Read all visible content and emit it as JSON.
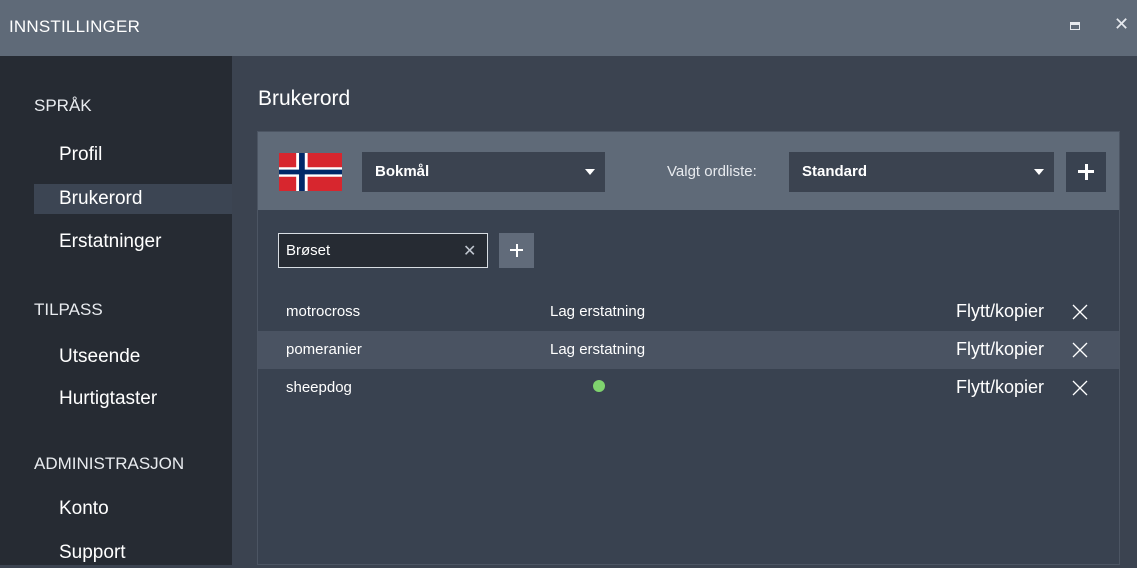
{
  "window": {
    "title": "INNSTILLINGER",
    "maximize_icon": "maximize-icon",
    "close_icon": "close-icon"
  },
  "sidebar": {
    "sections": [
      {
        "heading": "SPRÅK",
        "items": [
          "Profil",
          "Brukerord",
          "Erstatninger"
        ]
      },
      {
        "heading": "TILPASS",
        "items": [
          "Utseende",
          "Hurtigtaster"
        ]
      },
      {
        "heading": "ADMINISTRASJON",
        "items": [
          "Konto",
          "Support"
        ]
      }
    ],
    "active_item": "Brukerord"
  },
  "main": {
    "title": "Brukerord",
    "language": {
      "flag_icon": "norway-flag-icon",
      "selected": "Bokmål",
      "list_label": "Valgt ordliste:",
      "list_selected": "Standard",
      "add_list_icon": "plus-icon"
    },
    "search": {
      "value": "Brøset",
      "clear_icon": "clear-icon",
      "add_icon": "plus-icon"
    },
    "words": [
      {
        "word": "motrocross",
        "replacement": "Lag erstatning",
        "move": "Flytt/kopier"
      },
      {
        "word": "pomeranier",
        "replacement": "Lag erstatning",
        "move": "Flytt/kopier"
      },
      {
        "word": "sheepdog",
        "replacement": "",
        "status_dot": "green-dot",
        "move": "Flytt/kopier"
      }
    ],
    "colors": {
      "titlebar": "#5f6a78",
      "sidebar": "#262b33",
      "content": "#3b4350",
      "status_dot": "#7fd36e"
    }
  }
}
